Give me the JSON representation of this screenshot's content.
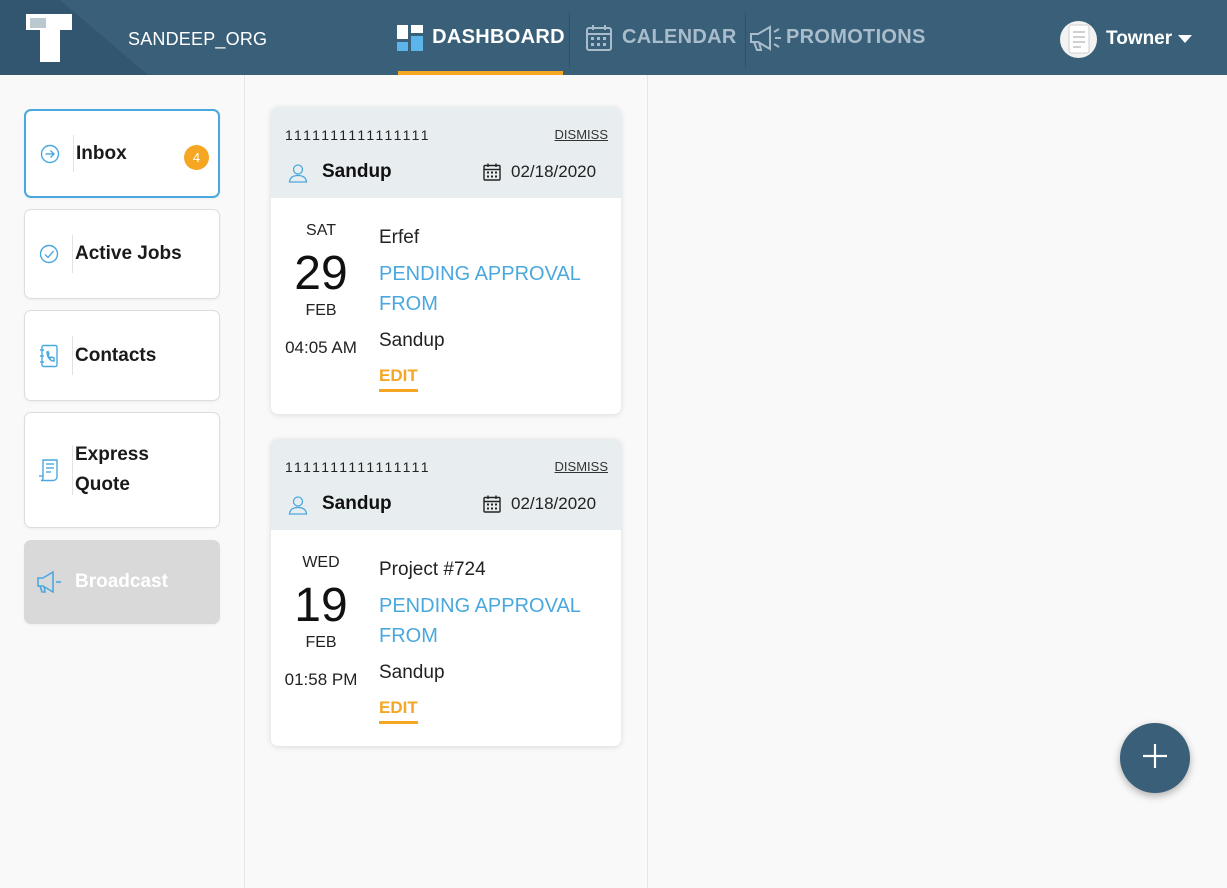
{
  "header": {
    "org_name": "SANDEEP_ORG",
    "tabs": [
      {
        "label": "DASHBOARD",
        "icon": "dashboard-icon",
        "active": true
      },
      {
        "label": "CALENDAR",
        "icon": "calendar-icon",
        "active": false
      },
      {
        "label": "PROMOTIONS",
        "icon": "megaphone-icon",
        "active": false
      }
    ],
    "user": {
      "name": "Towner",
      "icon": "avatar"
    }
  },
  "sidebar": {
    "items": [
      {
        "label": "Inbox",
        "icon": "arrow-circle-icon",
        "badge": "4",
        "active": true
      },
      {
        "label": "Active Jobs",
        "icon": "check-circle-icon",
        "active": false
      },
      {
        "label": "Contacts",
        "icon": "address-book-icon",
        "active": false
      },
      {
        "label": "Express Quote",
        "icon": "quote-document-icon",
        "active": false
      },
      {
        "label": "Broadcast",
        "icon": "megaphone-icon",
        "disabled": true
      }
    ]
  },
  "cards": [
    {
      "id": "1111111111111111",
      "dismiss": "DISMISS",
      "person": "Sandup",
      "date": "02/18/2020",
      "dow": "SAT",
      "day": "29",
      "month": "FEB",
      "time": "04:05 AM",
      "title": "Erfef",
      "status": "PENDING APPROVAL FROM",
      "requester": "Sandup",
      "action": "EDIT"
    },
    {
      "id": "1111111111111111",
      "dismiss": "DISMISS",
      "person": "Sandup",
      "date": "02/18/2020",
      "dow": "WED",
      "day": "19",
      "month": "FEB",
      "time": "01:58 PM",
      "title": "Project #724",
      "status": "PENDING APPROVAL FROM",
      "requester": "Sandup",
      "action": "EDIT"
    }
  ],
  "fab": {
    "icon": "plus-icon"
  },
  "colors": {
    "header_bg": "#3a6079",
    "accent": "#f5a623",
    "link_blue": "#4aa8de",
    "card_head_bg": "#e8eef0"
  }
}
